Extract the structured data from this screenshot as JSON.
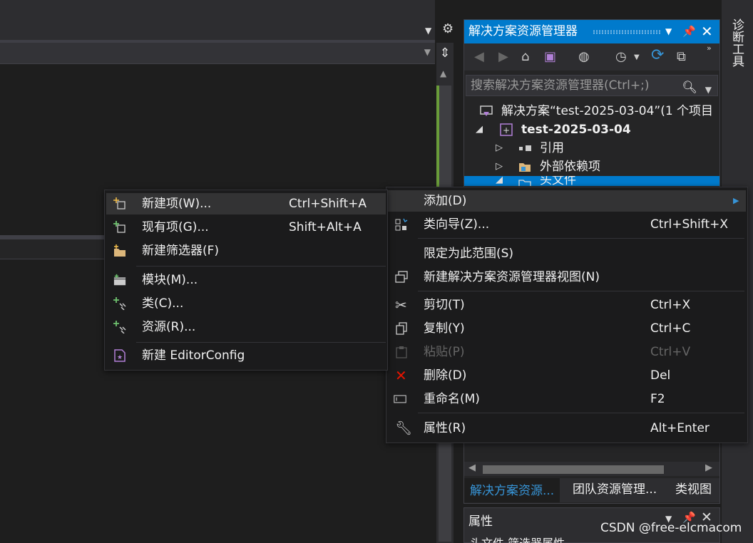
{
  "solution_explorer": {
    "title": "解决方案资源管理器",
    "search_placeholder": "搜索解决方案资源管理器(Ctrl+;)",
    "tree": [
      {
        "label": "解决方案“test-2025-03-04”(1 个项目"
      },
      {
        "label": "test-2025-03-04"
      },
      {
        "label": "引用"
      },
      {
        "label": "外部依赖项"
      },
      {
        "label": "头文件"
      }
    ],
    "tabs": [
      "解决方案资源...",
      "团队资源管理...",
      "类视图"
    ]
  },
  "properties_panel": {
    "title": "属性",
    "subtitle": "头文件 筛选器属性"
  },
  "right_rail": {
    "label": "诊断工具"
  },
  "context_menu": {
    "items": [
      {
        "label": "添加(D)",
        "shortcut": "",
        "icon": "submenu",
        "state": "hover"
      },
      {
        "label": "类向导(Z)...",
        "shortcut": "Ctrl+Shift+X",
        "icon": "class-wizard-icon"
      },
      {
        "label": "限定为此范围(S)",
        "shortcut": "",
        "icon": ""
      },
      {
        "label": "新建解决方案资源管理器视图(N)",
        "shortcut": "",
        "icon": "new-view-icon"
      },
      {
        "label": "剪切(T)",
        "shortcut": "Ctrl+X",
        "icon": "scissors-icon"
      },
      {
        "label": "复制(Y)",
        "shortcut": "Ctrl+C",
        "icon": "copy-icon"
      },
      {
        "label": "粘贴(P)",
        "shortcut": "Ctrl+V",
        "icon": "paste-icon",
        "state": "disabled"
      },
      {
        "label": "删除(D)",
        "shortcut": "Del",
        "icon": "delete-icon"
      },
      {
        "label": "重命名(M)",
        "shortcut": "F2",
        "icon": "rename-icon"
      },
      {
        "label": "属性(R)",
        "shortcut": "Alt+Enter",
        "icon": "wrench-icon"
      }
    ]
  },
  "add_submenu": {
    "items": [
      {
        "label": "新建项(W)...",
        "shortcut": "Ctrl+Shift+A",
        "icon": "new-item-icon",
        "state": "hover"
      },
      {
        "label": "现有项(G)...",
        "shortcut": "Shift+Alt+A",
        "icon": "existing-item-icon"
      },
      {
        "label": "新建筛选器(F)",
        "shortcut": "",
        "icon": "new-filter-icon"
      },
      {
        "label": "模块(M)...",
        "shortcut": "",
        "icon": "module-icon"
      },
      {
        "label": "类(C)...",
        "shortcut": "",
        "icon": "class-icon"
      },
      {
        "label": "资源(R)...",
        "shortcut": "",
        "icon": "resource-icon"
      },
      {
        "label": "新建 EditorConfig",
        "shortcut": "",
        "icon": "editorconfig-icon"
      }
    ]
  },
  "watermark": "CSDN @free-elcmacom",
  "colors": {
    "accent": "#007acc",
    "background": "#1e1e1e",
    "menu": "#1b1b1c",
    "disabled": "#656565"
  }
}
